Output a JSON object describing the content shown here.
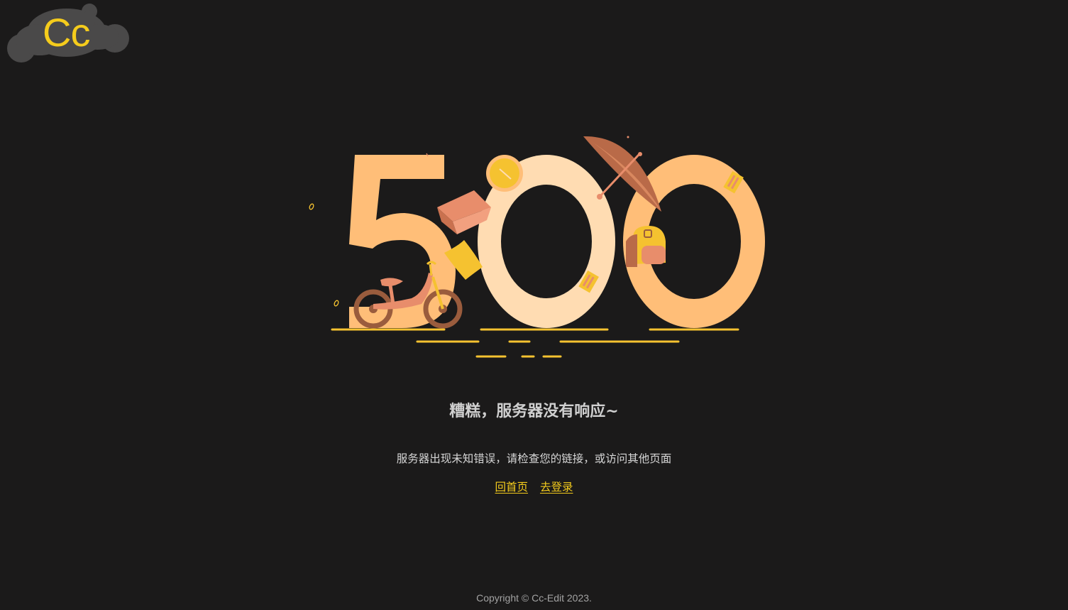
{
  "logo": {
    "text": "Cc",
    "blob_color": "#4a4949",
    "text_color": "#f5cc1c"
  },
  "illustration": {
    "digits": "500",
    "colors": {
      "five": "#ffbe78",
      "zero_one": "#ffdcb2",
      "zero_two": "#ffbe78",
      "accent": "#f5c230",
      "brown": "#9a5c3d",
      "salmon": "#e88d6b"
    }
  },
  "message": {
    "title": "糟糕，服务器没有响应~",
    "description": "服务器出现未知错误，请检查您的链接，或访问其他页面"
  },
  "links": {
    "home": "回首页",
    "login": "去登录"
  },
  "footer": {
    "copyright": "Copyright © Cc-Edit 2023."
  },
  "theme": {
    "background": "#1b1a1a",
    "link_color": "#f5cc1c"
  }
}
